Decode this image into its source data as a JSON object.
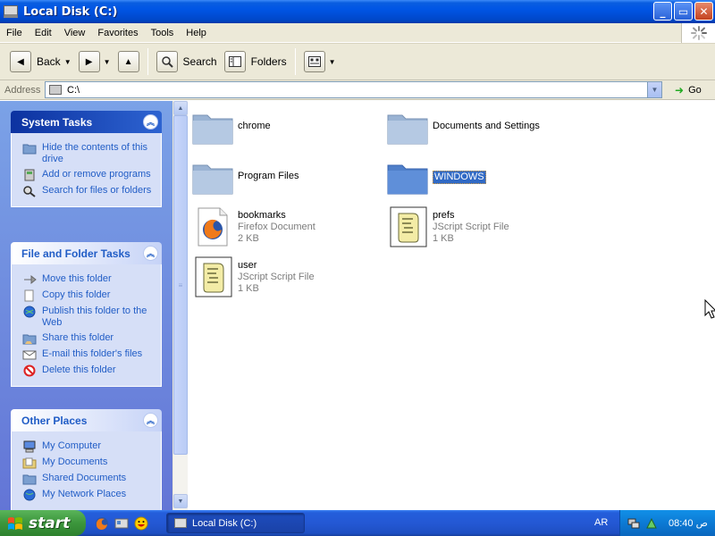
{
  "window": {
    "title": "Local Disk (C:)",
    "buttons": {
      "minimize": "_",
      "maximize": "▭",
      "close": "✕"
    }
  },
  "menu": [
    "File",
    "Edit",
    "View",
    "Favorites",
    "Tools",
    "Help"
  ],
  "toolbar": {
    "back_label": "Back",
    "search_label": "Search",
    "folders_label": "Folders"
  },
  "address": {
    "label": "Address",
    "value": "C:\\",
    "go_label": "Go"
  },
  "sidebar": {
    "system_tasks": {
      "title": "System Tasks",
      "items": [
        {
          "label": "Hide the contents of this drive",
          "icon": "folder-hide-icon"
        },
        {
          "label": "Add or remove programs",
          "icon": "add-remove-programs-icon"
        },
        {
          "label": "Search for files or folders",
          "icon": "search-files-icon"
        }
      ]
    },
    "file_folder_tasks": {
      "title": "File and Folder Tasks",
      "items": [
        {
          "label": "Move this folder",
          "icon": "move-icon"
        },
        {
          "label": "Copy this folder",
          "icon": "copy-icon"
        },
        {
          "label": "Publish this folder to the Web",
          "icon": "publish-web-icon"
        },
        {
          "label": "Share this folder",
          "icon": "share-icon"
        },
        {
          "label": "E-mail this folder's files",
          "icon": "email-icon"
        },
        {
          "label": "Delete this folder",
          "icon": "delete-icon"
        }
      ]
    },
    "other_places": {
      "title": "Other Places",
      "items": [
        {
          "label": "My Computer",
          "icon": "my-computer-icon"
        },
        {
          "label": "My Documents",
          "icon": "my-documents-icon"
        },
        {
          "label": "Shared Documents",
          "icon": "shared-documents-icon"
        },
        {
          "label": "My Network Places",
          "icon": "network-places-icon"
        }
      ]
    }
  },
  "files": [
    {
      "name": "chrome",
      "type": "folder"
    },
    {
      "name": "Documents and Settings",
      "type": "folder"
    },
    {
      "name": "Program Files",
      "type": "folder"
    },
    {
      "name": "WINDOWS",
      "type": "folder",
      "selected": true
    },
    {
      "name": "bookmarks",
      "type": "file",
      "kind": "Firefox Document",
      "size": "2 KB",
      "icon": "firefox-document-icon"
    },
    {
      "name": "prefs",
      "type": "file",
      "kind": "JScript Script File",
      "size": "1 KB",
      "icon": "jscript-file-icon"
    },
    {
      "name": "user",
      "type": "file",
      "kind": "JScript Script File",
      "size": "1 KB",
      "icon": "jscript-file-icon"
    }
  ],
  "taskbar": {
    "start_label": "start",
    "task_label": "Local Disk (C:)",
    "language": "AR",
    "clock": "08:40",
    "clock_suffix": "ص"
  },
  "colors": {
    "title_blue": "#0055e5",
    "sidebar_bg": "#7ba2e7",
    "link_blue": "#215dc6",
    "selection": "#316ac5",
    "start_green": "#3c963c"
  }
}
